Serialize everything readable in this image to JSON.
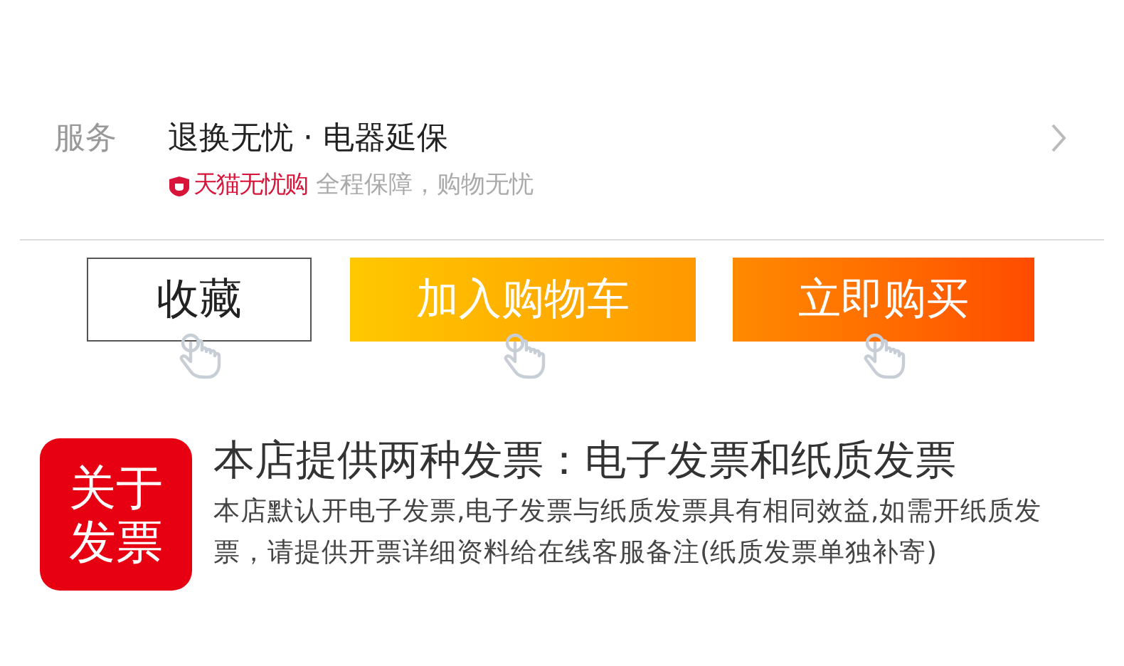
{
  "service": {
    "label": "服务",
    "value": "退换无忧 · 电器延保",
    "badge": "天猫无忧购",
    "note": "全程保障，购物无忧"
  },
  "buttons": [
    {
      "label": "收藏",
      "kind": "outline"
    },
    {
      "label": "加入购物车",
      "kind": "cart"
    },
    {
      "label": "立即购买",
      "kind": "buy"
    }
  ],
  "invoice": {
    "badge": "关于发票",
    "title": "本店提供两种发票：电子发票和纸质发票",
    "body": "本店默认开电子发票,电子发票与纸质发票具有相同效益,如需开纸质发票，请提供开票详细资料给在线客服备注(纸质发票单独补寄)"
  }
}
